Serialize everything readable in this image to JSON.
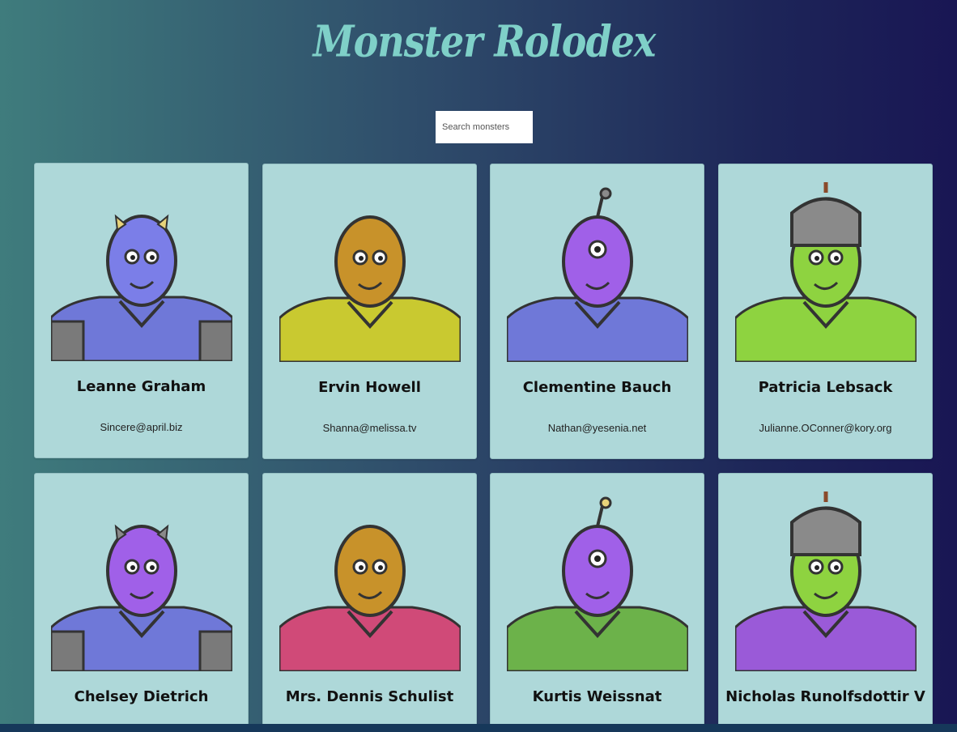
{
  "header": {
    "title": "Monster Rolodex"
  },
  "search": {
    "placeholder": "Search monsters"
  },
  "monsters": [
    {
      "name": "Leanne Graham",
      "email": "Sincere@april.biz",
      "skin": "#7b7ee8",
      "body": "#6f78d8",
      "accent": "#e8d37a"
    },
    {
      "name": "Ervin Howell",
      "email": "Shanna@melissa.tv",
      "skin": "#c8922a",
      "body": "#c9c930",
      "accent": "#3a3a3a"
    },
    {
      "name": "Clementine Bauch",
      "email": "Nathan@yesenia.net",
      "skin": "#a060e8",
      "body": "#6f78d8",
      "accent": "#8a8a8a"
    },
    {
      "name": "Patricia Lebsack",
      "email": "Julianne.OConner@kory.org",
      "skin": "#8ed340",
      "body": "#8ed340",
      "accent": "#9a9a9a"
    },
    {
      "name": "Chelsey Dietrich",
      "email": "",
      "skin": "#a060e8",
      "body": "#6f78d8",
      "accent": "#8a8a8a"
    },
    {
      "name": "Mrs. Dennis Schulist",
      "email": "",
      "skin": "#c8922a",
      "body": "#d04a78",
      "accent": "#3a3a3a"
    },
    {
      "name": "Kurtis Weissnat",
      "email": "",
      "skin": "#a060e8",
      "body": "#6cb24a",
      "accent": "#e8d37a"
    },
    {
      "name": "Nicholas Runolfsdottir V",
      "email": "",
      "skin": "#8ed340",
      "body": "#9a5ad8",
      "accent": "#8a8a8a"
    }
  ]
}
